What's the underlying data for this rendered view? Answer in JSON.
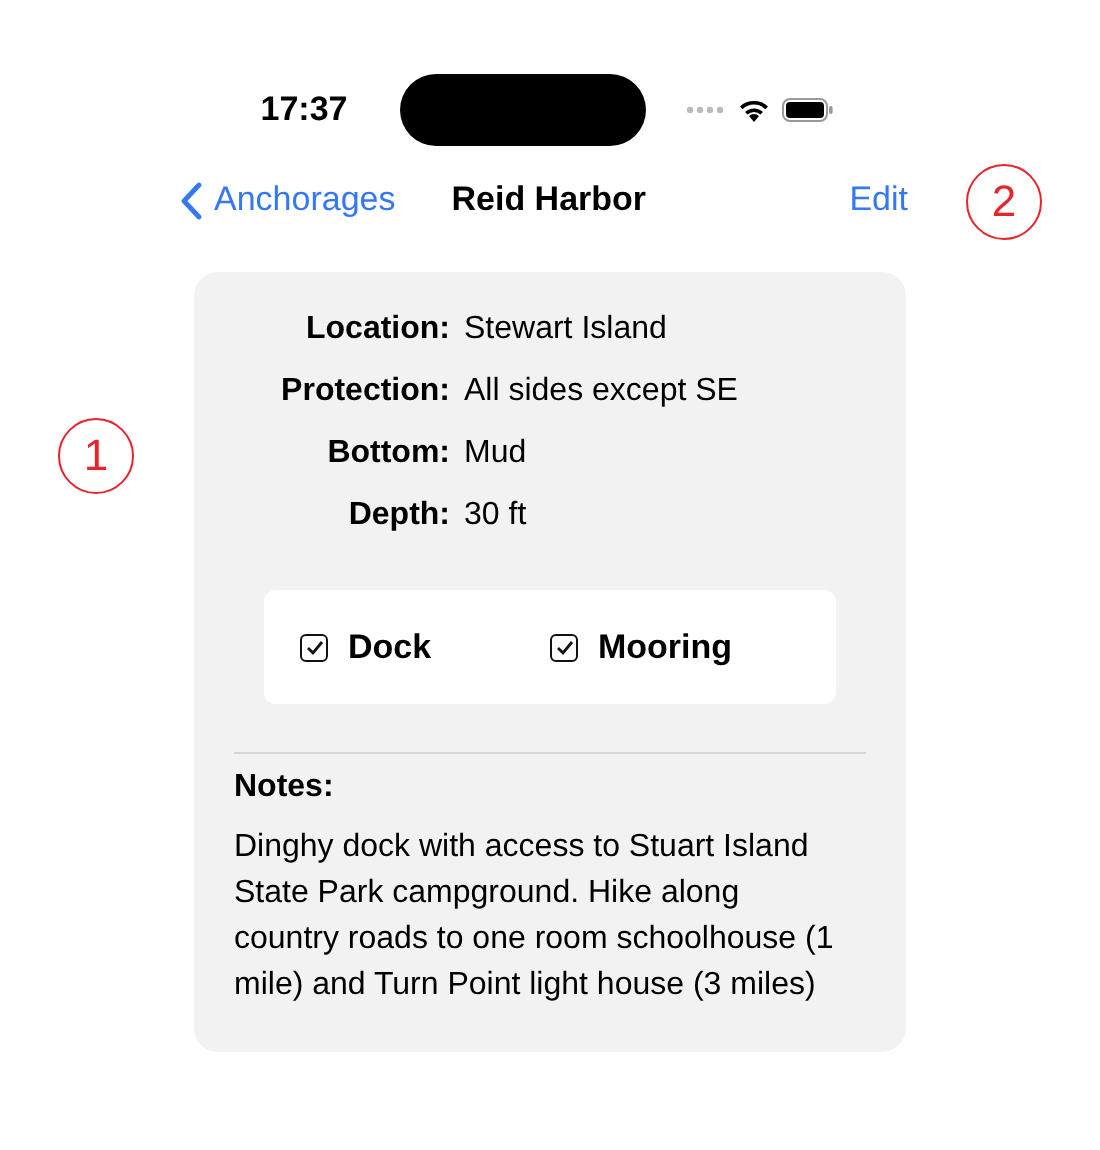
{
  "status_bar": {
    "time": "17:37"
  },
  "nav_bar": {
    "back": "Anchorages",
    "title": "Reid Harbor",
    "action": "Edit"
  },
  "details": [
    {
      "label": "Location:",
      "value": "Stewart Island"
    },
    {
      "label": "Protection:",
      "value": "All sides except SE"
    },
    {
      "label": "Bottom:",
      "value": "Mud"
    },
    {
      "label": "Depth:",
      "value": "30 ft"
    }
  ],
  "amenities": [
    {
      "label": "Dock",
      "checked": true
    },
    {
      "label": "Mooring",
      "checked": true
    }
  ],
  "notes": {
    "label": "Notes:",
    "text": "Dinghy dock with access to Stuart Island State Park campground. Hike along country roads to one room schoolhouse (1 mile) and Turn Point light house (3 miles)"
  },
  "callouts": [
    "1",
    "2"
  ]
}
